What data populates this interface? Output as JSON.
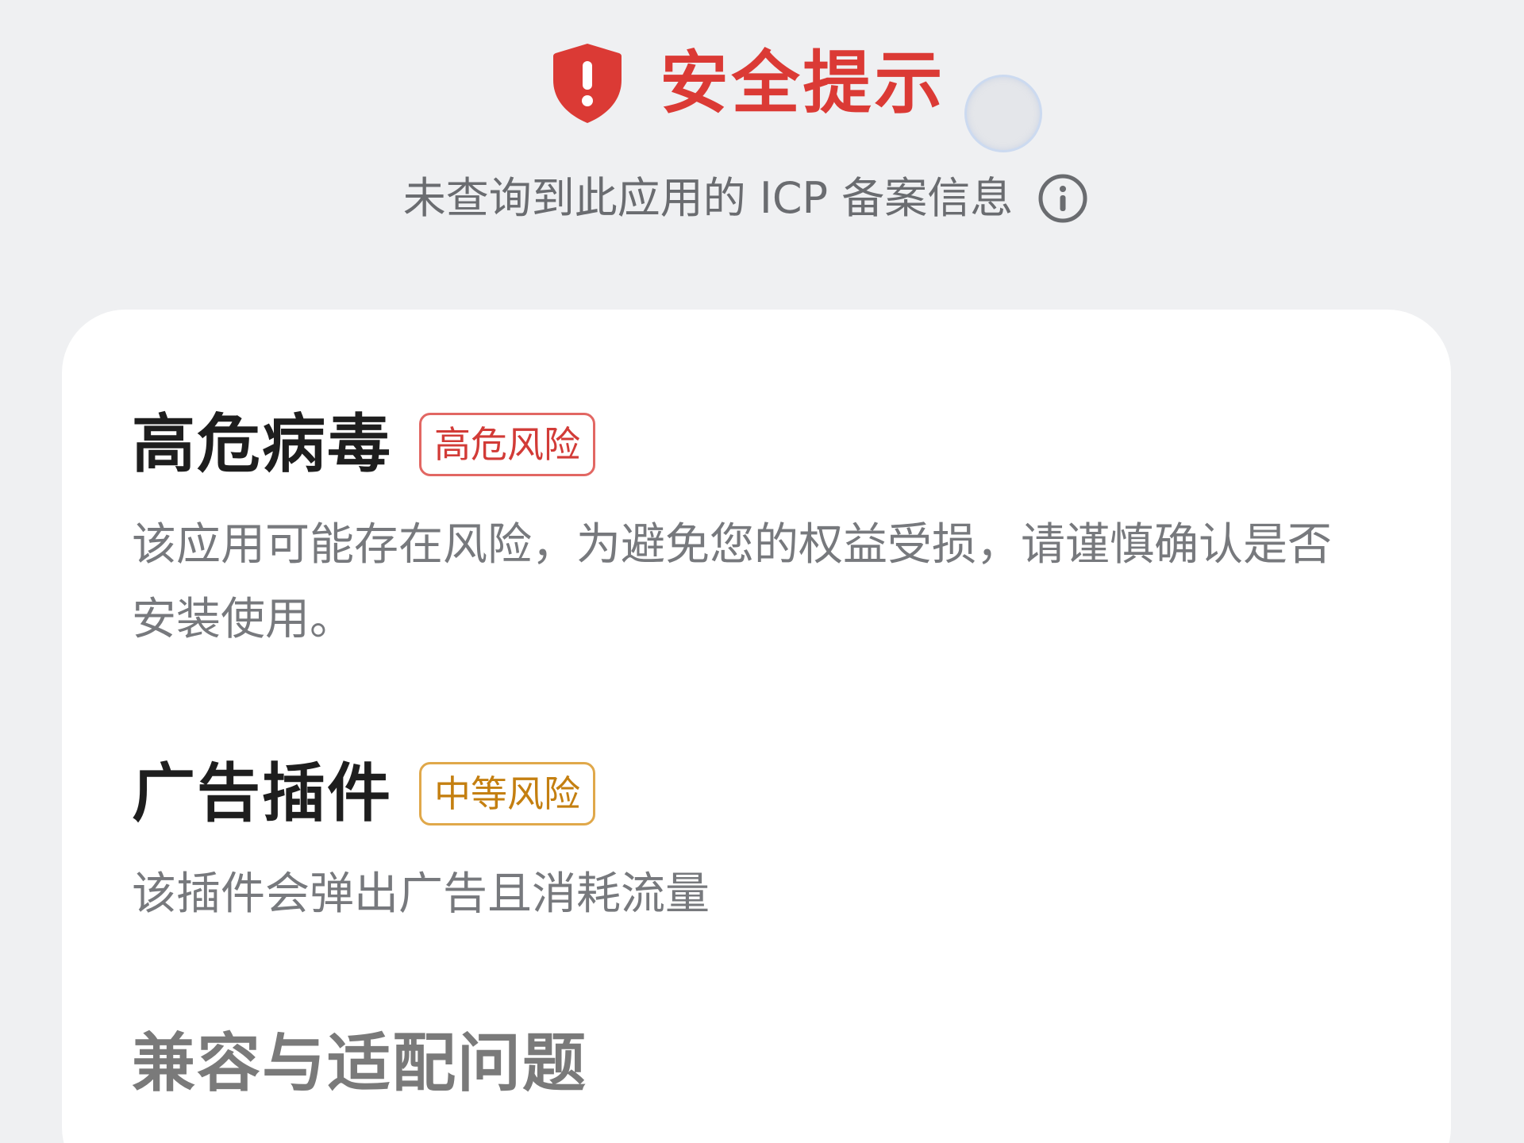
{
  "header": {
    "title": "安全提示",
    "icon": "shield-alert-icon",
    "title_color": "#db3a35"
  },
  "subtitle": {
    "text": "未查询到此应用的 ICP 备案信息",
    "icon": "info-icon"
  },
  "risks": [
    {
      "title": "高危病毒",
      "badge": "高危风险",
      "badge_color": "#d23b37",
      "description": "该应用可能存在风险，为避免您的权益受损，请谨慎确认是否安装使用。"
    },
    {
      "title": "广告插件",
      "badge": "中等风险",
      "badge_color": "#c47f10",
      "description": "该插件会弹出广告且消耗流量"
    },
    {
      "title": "兼容与适配问题"
    }
  ]
}
